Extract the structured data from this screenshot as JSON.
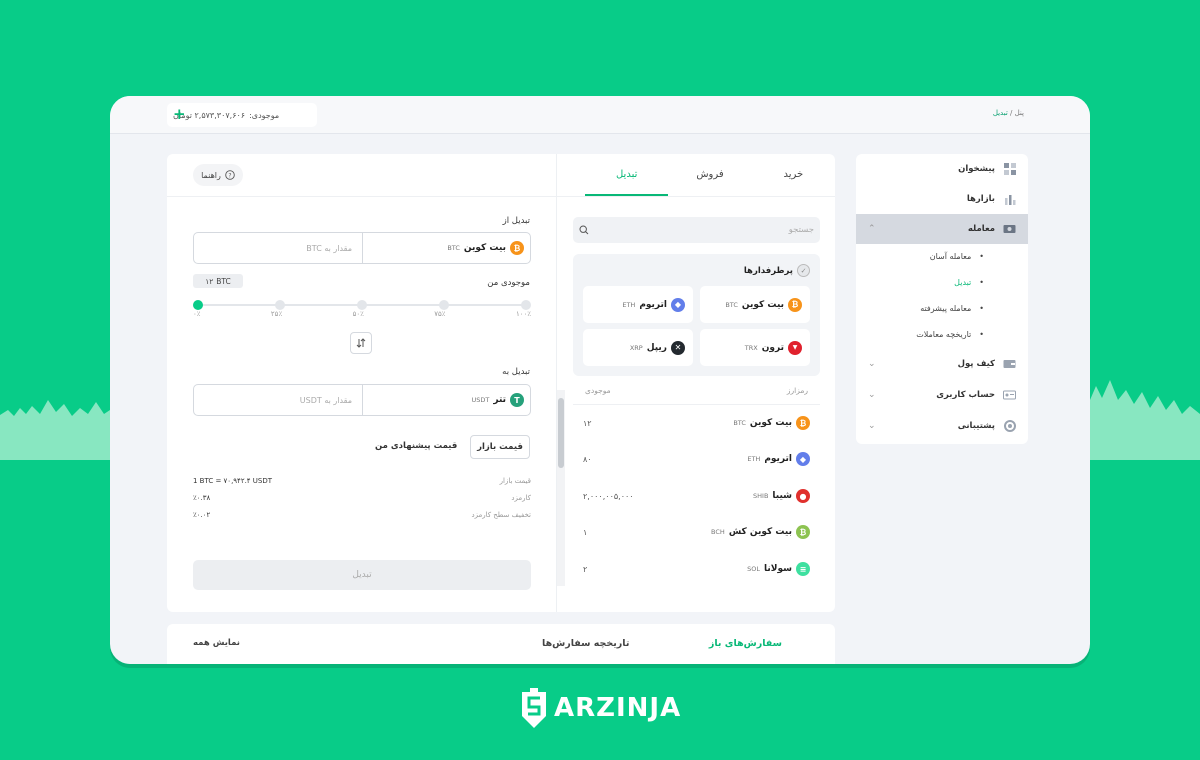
{
  "topbar": {
    "balance_label": "موجودی:",
    "balance_value": "۲,۵۷۳,۳۰۷,۶۰۶ تومان",
    "add_symbol": "+",
    "breadcrumb_home": "پنل",
    "breadcrumb_sep": "/",
    "breadcrumb_current": "تبدیل"
  },
  "tabs": [
    "خرید",
    "فروش",
    "تبدیل"
  ],
  "guide_label": "راهنما",
  "form": {
    "from_label": "تبدیل از",
    "from_coin": "بیت کوین",
    "from_symbol": "BTC",
    "from_placeholder": "مقدار به BTC",
    "balance_label": "موجودی من",
    "balance_value": "۱۲",
    "balance_unit": "BTC",
    "slider_ticks": [
      "۰٪",
      "۲۵٪",
      "۵۰٪",
      "۷۵٪",
      "۱۰۰٪"
    ],
    "to_label": "تبدیل به",
    "to_coin": "تتر",
    "to_symbol": "USDT",
    "to_placeholder": "مقدار به USDT",
    "market_price_button": "قیمت بازار",
    "suggested_price": "قیمت پیشنهادی من",
    "info": [
      {
        "label": "قیمت بازار",
        "value": "1 BTC = ۷۰,۹۴۲.۴ USDT"
      },
      {
        "label": "کارمزد",
        "value": "٪۰.۳۸"
      },
      {
        "label": "تخفیف سطح کارمزد",
        "value": "٪۰.۰۲"
      }
    ],
    "convert_button": "تبدیل"
  },
  "market": {
    "search_placeholder": "جستجو",
    "favorites_title": "پرطرفدارها",
    "favorites": [
      {
        "name": "بیت کوین",
        "symbol": "BTC",
        "color": "#f7931a",
        "glyph": "₿"
      },
      {
        "name": "اتریوم",
        "symbol": "ETH",
        "color": "#627eea",
        "glyph": "◆"
      },
      {
        "name": "ترون",
        "symbol": "TRX",
        "color": "#e0212d",
        "glyph": "▼"
      },
      {
        "name": "ریپل",
        "symbol": "XRP",
        "color": "#23292f",
        "glyph": "✕"
      }
    ],
    "col_symbol": "رمزارز",
    "col_balance": "موجودی",
    "coins": [
      {
        "name": "بیت کوین",
        "symbol": "BTC",
        "qty": "۱۲",
        "color": "#f7931a",
        "glyph": "₿"
      },
      {
        "name": "اتریوم",
        "symbol": "ETH",
        "qty": "۸۰",
        "color": "#627eea",
        "glyph": "◆"
      },
      {
        "name": "شیبا",
        "symbol": "SHIB",
        "qty": "۲,۰۰۰,۰۰۵,۰۰۰",
        "color": "#e0302d",
        "glyph": "●"
      },
      {
        "name": "بیت کوین کش",
        "symbol": "BCH",
        "qty": "۱",
        "color": "#8dc351",
        "glyph": "₿"
      },
      {
        "name": "سولانا",
        "symbol": "SOL",
        "qty": "۲",
        "color": "#3ee0a0",
        "glyph": "≡"
      }
    ]
  },
  "bottom": {
    "open_orders": "سفارش‌های باز",
    "order_history": "تاریخچه سفارش‌ها",
    "show_all": "نمایش همه"
  },
  "sidebar": {
    "items": [
      {
        "label": "پیشخوان"
      },
      {
        "label": "بازارها"
      },
      {
        "label": "معامله"
      },
      {
        "label": "کیف پول"
      },
      {
        "label": "حساب کاربری"
      },
      {
        "label": "پشتیبانی"
      }
    ],
    "sub": [
      {
        "label": "معامله آسان"
      },
      {
        "label": "تبدیل"
      },
      {
        "label": "معامله پیشرفته"
      },
      {
        "label": "تاریخچه معاملات"
      }
    ]
  },
  "brand": {
    "name": "ARZINJA",
    "color": "#08cc88"
  }
}
